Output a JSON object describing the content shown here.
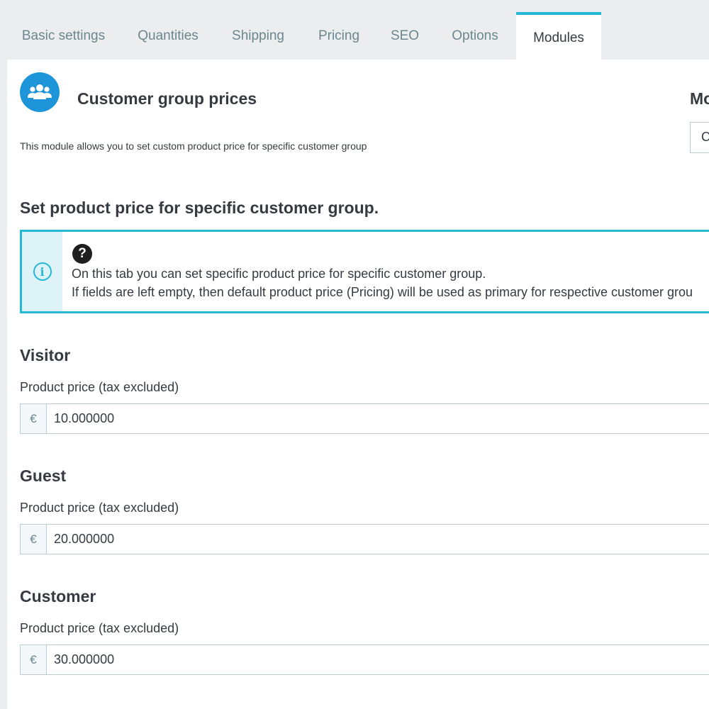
{
  "tabs": [
    {
      "label": "Basic settings"
    },
    {
      "label": "Quantities"
    },
    {
      "label": "Shipping"
    },
    {
      "label": "Pricing"
    },
    {
      "label": "SEO"
    },
    {
      "label": "Options"
    },
    {
      "label": "Modules",
      "active": true
    }
  ],
  "module": {
    "icon": "users-icon",
    "title": "Customer group prices",
    "description": "This module allows you to set custom product price for specific customer group",
    "right_title": "Mo",
    "right_select_value": "C"
  },
  "section": {
    "title": "Set product price for specific customer group."
  },
  "info": {
    "icon": "info-icon",
    "help_icon": "question-circle-icon",
    "line1": "On this tab you can set specific product price for specific customer group.",
    "line2": "If fields are left empty, then default product price (Pricing) will be used as primary for respective customer grou"
  },
  "groups": [
    {
      "name": "Visitor",
      "label": "Product price (tax excluded)",
      "currency": "€",
      "value": "10.000000"
    },
    {
      "name": "Guest",
      "label": "Product price (tax excluded)",
      "currency": "€",
      "value": "20.000000"
    },
    {
      "name": "Customer",
      "label": "Product price (tax excluded)",
      "currency": "€",
      "value": "30.000000"
    }
  ],
  "colors": {
    "accent": "#25b9d7",
    "icon_bg": "#1e94d9",
    "text": "#363a41",
    "muted": "#6c868e"
  }
}
